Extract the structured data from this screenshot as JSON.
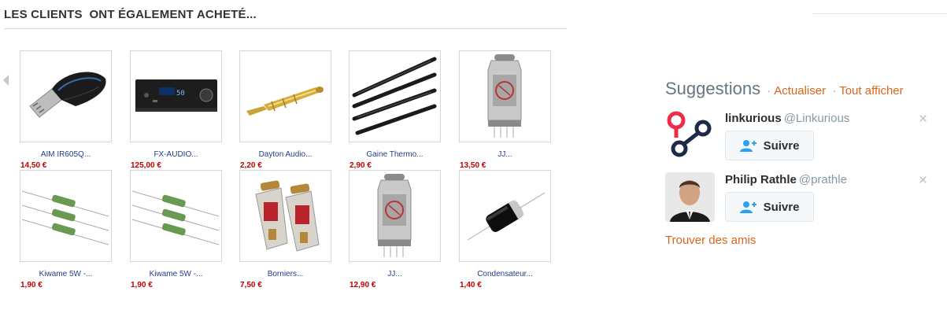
{
  "section": {
    "title": "LES CLIENTS  ONT ÉGALEMENT ACHETÉ..."
  },
  "carousel": {
    "prev_icon": "chevron-left-icon"
  },
  "products": [
    {
      "name": "AIM IR605Q...",
      "price": "14,50 €",
      "image": "usb-receiver"
    },
    {
      "name": "FX-AUDIO...",
      "price": "125,00 €",
      "image": "amplifier"
    },
    {
      "name": "Dayton Audio...",
      "price": "2,20 €",
      "image": "banana-plug"
    },
    {
      "name": "Gaine Thermo...",
      "price": "2,90 €",
      "image": "heat-shrink"
    },
    {
      "name": "JJ...",
      "price": "13,50 €",
      "image": "vacuum-tube"
    },
    {
      "name": "Kiwame 5W -...",
      "price": "1,90 €",
      "image": "resistors"
    },
    {
      "name": "Kiwame 5W -...",
      "price": "1,90 €",
      "image": "resistors"
    },
    {
      "name": "Borniers...",
      "price": "7,50 €",
      "image": "binding-posts"
    },
    {
      "name": "JJ...",
      "price": "12,90 €",
      "image": "vacuum-tube"
    },
    {
      "name": "Condensateur...",
      "price": "1,40 €",
      "image": "capacitor"
    }
  ],
  "suggestions": {
    "title": "Suggestions",
    "separator": "·",
    "refresh": "Actualiser",
    "view_all": "Tout afficher",
    "users": [
      {
        "name": "linkurious",
        "handle": "@Linkurious",
        "follow": "Suivre",
        "avatar": "linkurious-logo"
      },
      {
        "name": "Philip Rathle",
        "handle": "@prathle",
        "follow": "Suivre",
        "avatar": "person-photo"
      }
    ],
    "dismiss": "×",
    "find_friends": "Trouver des amis"
  },
  "colors": {
    "accent_link": "#d8661c",
    "price": "#c00000",
    "product_link": "#1f3f8c"
  }
}
